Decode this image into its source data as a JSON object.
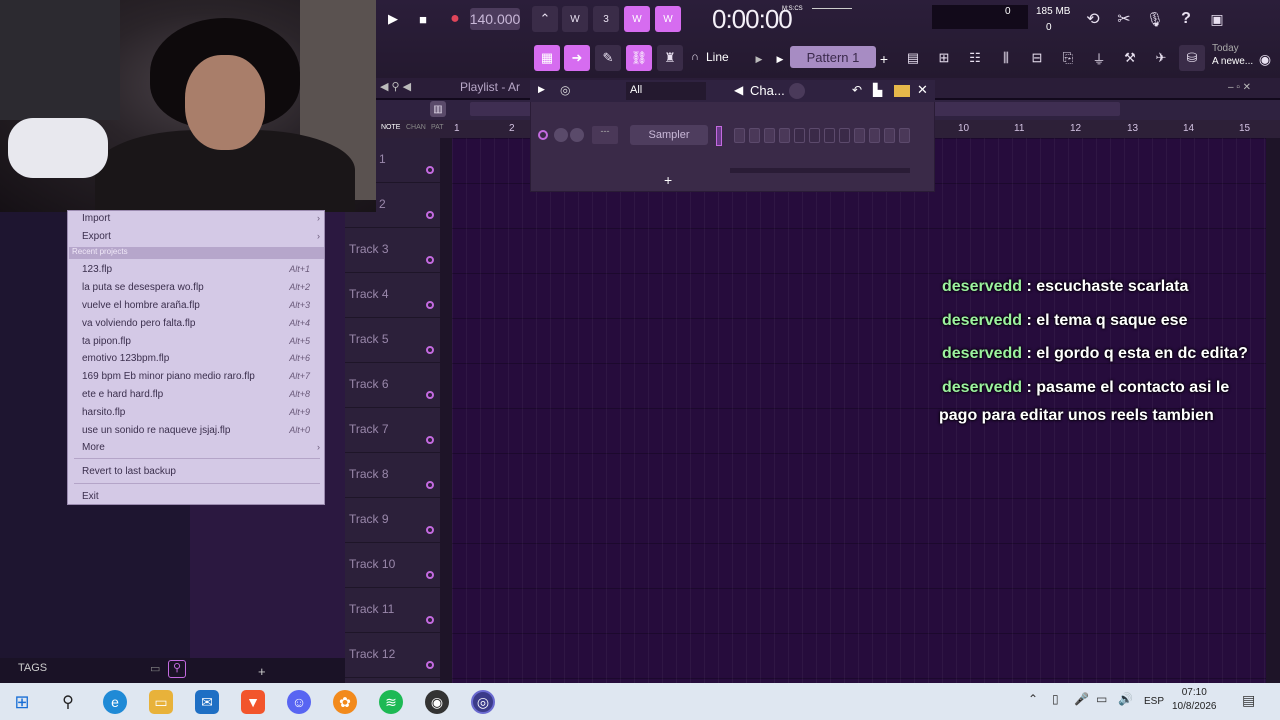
{
  "toolbar": {
    "tempo": "140.000",
    "time": "0:00:00",
    "time_unit": "M:S:CS",
    "memory": "185 MB",
    "memory_cpu_zero_1": "0",
    "memory_cpu_zero_2": "0",
    "snap_mode": "Line",
    "pattern": "Pattern 1",
    "news_title": "Today",
    "news_text": "A newe..."
  },
  "playlist": {
    "title": "Playlist - Ar",
    "ruler_numbers": [
      "1",
      "2",
      "10",
      "11",
      "12",
      "13",
      "14",
      "15"
    ],
    "header_labels": {
      "note": "NOTE",
      "chan": "CHAN",
      "pat": "PAT"
    },
    "tracks": [
      "1",
      "2",
      "Track 3",
      "Track 4",
      "Track 5",
      "Track 6",
      "Track 7",
      "Track 8",
      "Track 9",
      "Track 10",
      "Track 11",
      "Track 12"
    ]
  },
  "channel_rack": {
    "filter": "All",
    "title": "Cha...",
    "channel_name": "Sampler",
    "add_symbol": "+"
  },
  "browser": {
    "tags_label": "TAGS",
    "add_symbol": "+"
  },
  "file_menu": {
    "import": "Import",
    "export": "Export",
    "recent_header": "Recent projects",
    "recent": [
      {
        "name": "123.flp",
        "shortcut": "Alt+1"
      },
      {
        "name": "la puta se desespera wo.flp",
        "shortcut": "Alt+2"
      },
      {
        "name": "vuelve el hombre araña.flp",
        "shortcut": "Alt+3"
      },
      {
        "name": "va volviendo pero falta.flp",
        "shortcut": "Alt+4"
      },
      {
        "name": "ta pipon.flp",
        "shortcut": "Alt+5"
      },
      {
        "name": "emotivo 123bpm.flp",
        "shortcut": "Alt+6"
      },
      {
        "name": "169 bpm Eb minor piano medio raro.flp",
        "shortcut": "Alt+7"
      },
      {
        "name": "ete e hard hard.flp",
        "shortcut": "Alt+8"
      },
      {
        "name": "harsito.flp",
        "shortcut": "Alt+9"
      },
      {
        "name": "use un sonido re naqueve jsjaj.flp",
        "shortcut": "Alt+0"
      }
    ],
    "more": "More",
    "revert": "Revert to last backup",
    "exit": "Exit"
  },
  "chat": [
    {
      "user": "deservedd",
      "text": ": escuchaste scarlata"
    },
    {
      "user": "deservedd",
      "text": ": el tema q saque ese"
    },
    {
      "user": "deservedd",
      "text": ": el gordo q esta en dc edita?"
    },
    {
      "user": "deservedd",
      "text": ": pasame el contacto asi le",
      "text2": "pago para editar unos reels tambien"
    }
  ],
  "taskbar": {
    "language": "ESP",
    "time": "07:10",
    "date": "10/8/2026"
  },
  "colors": {
    "accent_pink": "#d66cf0",
    "chat_name": "#9cf29f",
    "menu_bg": "#d4c9e6"
  }
}
